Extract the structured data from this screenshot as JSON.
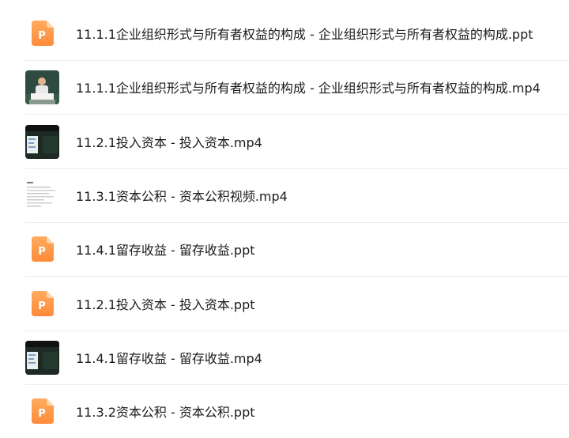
{
  "files": [
    {
      "name": "11.1.1企业组织形式与所有者权益的构成 - 企业组织形式与所有者权益的构成.ppt",
      "type": "ppt",
      "icon": "ppt-file-icon",
      "badge_letter": "P"
    },
    {
      "name": "11.1.1企业组织形式与所有者权益的构成 - 企业组织形式与所有者权益的构成.mp4",
      "type": "mp4",
      "icon": "video-thumbnail-lecturer"
    },
    {
      "name": "11.2.1投入资本 - 投入资本.mp4",
      "type": "mp4",
      "icon": "video-thumbnail-blackboard"
    },
    {
      "name": "11.3.1资本公积 - 资本公积视频.mp4",
      "type": "mp4",
      "icon": "video-thumbnail-document"
    },
    {
      "name": "11.4.1留存收益 - 留存收益.ppt",
      "type": "ppt",
      "icon": "ppt-file-icon",
      "badge_letter": "P"
    },
    {
      "name": "11.2.1投入资本 - 投入资本.ppt",
      "type": "ppt",
      "icon": "ppt-file-icon",
      "badge_letter": "P"
    },
    {
      "name": "11.4.1留存收益 - 留存收益.mp4",
      "type": "mp4",
      "icon": "video-thumbnail-blackboard"
    },
    {
      "name": "11.3.2资本公积 - 资本公积.ppt",
      "type": "ppt",
      "icon": "ppt-file-icon",
      "badge_letter": "P"
    }
  ],
  "colors": {
    "ppt_orange_top": "#ffab5e",
    "ppt_orange_bottom": "#ff8a3a",
    "text": "#1b1b1b",
    "divider": "#ededed"
  }
}
